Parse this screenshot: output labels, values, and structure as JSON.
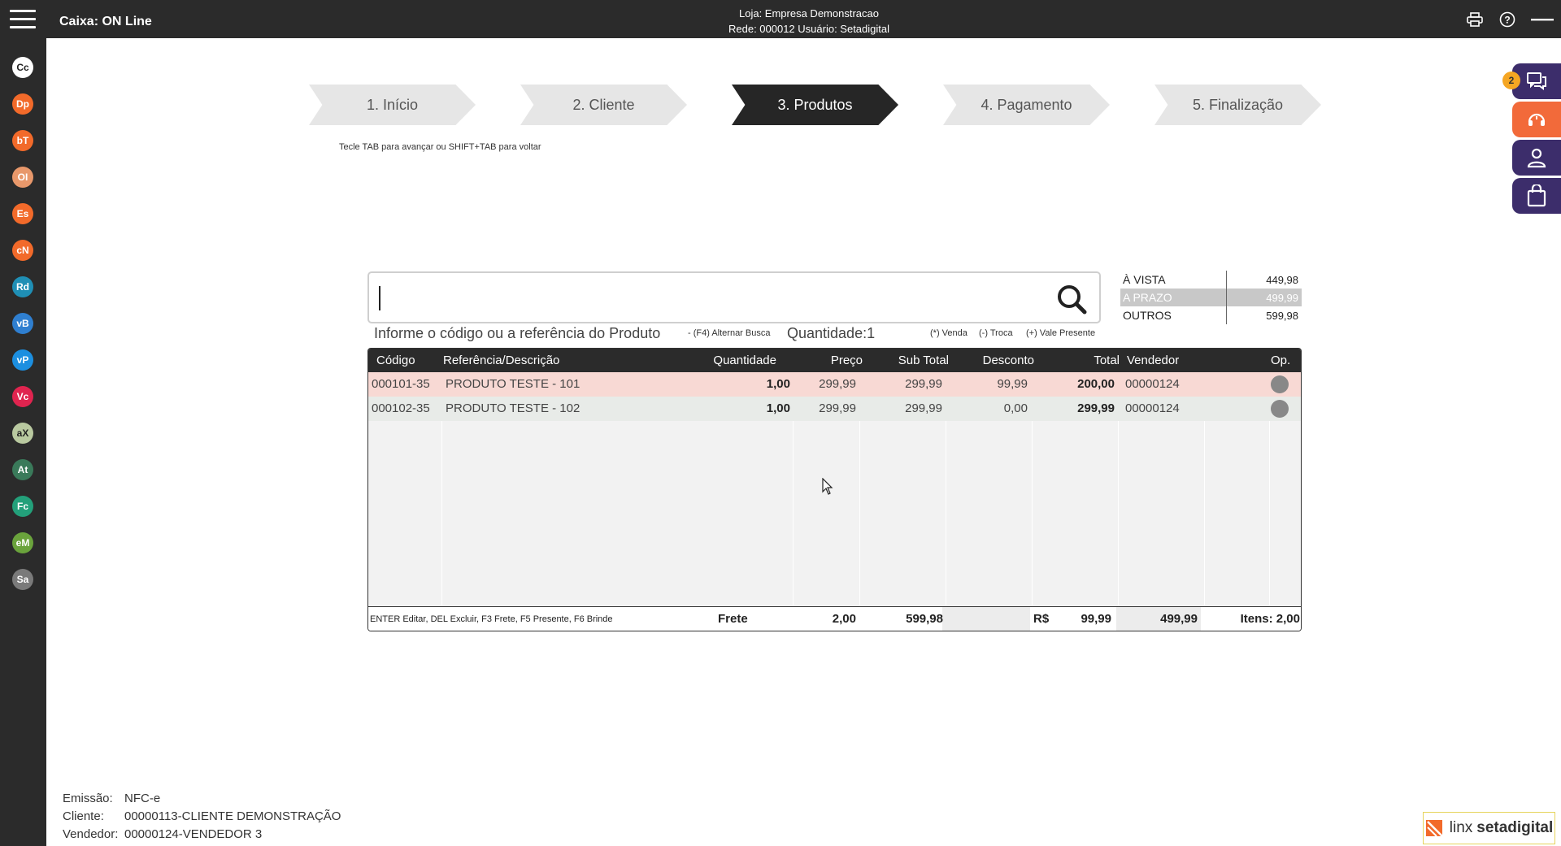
{
  "header": {
    "title": "Caixa: ON Line",
    "store": "Loja: Empresa Demonstracao",
    "network": "Rede: 000012 Usuário: Setadigital"
  },
  "sidebar": {
    "items": [
      {
        "abbr": "Cc",
        "color": "#ffffff",
        "text": "#222222"
      },
      {
        "abbr": "Dp",
        "color": "#f26a2a"
      },
      {
        "abbr": "bT",
        "color": "#f26a2a"
      },
      {
        "abbr": "OI",
        "color": "#e8986b"
      },
      {
        "abbr": "Es",
        "color": "#f26a2a"
      },
      {
        "abbr": "cN",
        "color": "#f26a2a"
      },
      {
        "abbr": "Rd",
        "color": "#1f8fb5"
      },
      {
        "abbr": "vB",
        "color": "#2f7fd0"
      },
      {
        "abbr": "vP",
        "color": "#1c8fe0"
      },
      {
        "abbr": "Vc",
        "color": "#e0244f"
      },
      {
        "abbr": "aX",
        "color": "#b9c9a0",
        "text": "#222222"
      },
      {
        "abbr": "At",
        "color": "#3a7a5a"
      },
      {
        "abbr": "Fc",
        "color": "#23a07a"
      },
      {
        "abbr": "eM",
        "color": "#6aa33c"
      },
      {
        "abbr": "Sa",
        "color": "#7a7a7a"
      }
    ]
  },
  "steps": [
    {
      "label": "1. Início",
      "active": false
    },
    {
      "label": "2. Cliente",
      "active": false
    },
    {
      "label": "3. Produtos",
      "active": true
    },
    {
      "label": "4. Pagamento",
      "active": false
    },
    {
      "label": "5. Finalização",
      "active": false
    }
  ],
  "hint": "Tecle TAB para avançar ou SHIFT+TAB para voltar",
  "search": {
    "value": "",
    "label": "Informe o código ou a referência do Produto",
    "alt": "- (F4) Alternar Busca",
    "quantity": "Quantidade:1",
    "legend_venda": "(*) Venda",
    "legend_troca": "(-) Troca",
    "legend_vale": "(+) Vale Presente"
  },
  "prices": [
    {
      "label": "À VISTA",
      "value": "449,98",
      "selected": false
    },
    {
      "label": "A PRAZO",
      "value": "499,99",
      "selected": true
    },
    {
      "label": "OUTROS",
      "value": "599,98",
      "selected": false
    }
  ],
  "table": {
    "headers": {
      "code": "Código",
      "desc": "Referência/Descrição",
      "qty": "Quantidade",
      "price": "Preço",
      "subtotal": "Sub Total",
      "discount": "Desconto",
      "total": "Total",
      "seller": "Vendedor",
      "op": "Op."
    },
    "rows": [
      {
        "code": "000101-35",
        "desc": "PRODUTO TESTE - 101",
        "qty": "1,00",
        "price": "299,99",
        "subtotal": "299,99",
        "discount": "99,99",
        "total": "200,00",
        "seller": "00000124"
      },
      {
        "code": "000102-35",
        "desc": "PRODUTO TESTE - 102",
        "qty": "1,00",
        "price": "299,99",
        "subtotal": "299,99",
        "discount": "0,00",
        "total": "299,99",
        "seller": "00000124"
      }
    ],
    "footer": {
      "shortcuts": "ENTER Editar, DEL Excluir, F3 Frete, F5 Presente, F6 Brinde",
      "freight_label": "Frete",
      "freight_value": "2,00",
      "subtotal": "599,98",
      "currency": "R$",
      "discount": "99,99",
      "total": "499,99",
      "items": "Itens: 2,00"
    }
  },
  "info": {
    "emission_label": "Emissão:",
    "emission": "NFC-e",
    "client_label": "Cliente:",
    "client": "00000113-CLIENTE DEMONSTRAÇÃO",
    "seller_label": "Vendedor:",
    "seller": "00000124-VENDEDOR 3"
  },
  "side_panel": {
    "badge": "2"
  },
  "logo": {
    "text1": "linx",
    "text2": "setadigital"
  }
}
